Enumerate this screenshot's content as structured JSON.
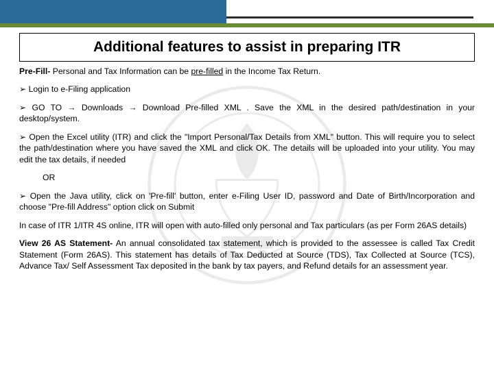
{
  "title": "Additional features to assist in preparing ITR",
  "prefill_label": "Pre-Fill-",
  "prefill_text_before": " Personal and Tax Information can be ",
  "prefill_underlined": "pre-filled",
  "prefill_text_after": " in the Income Tax Return.",
  "bullet1": "Login to e-Filing application",
  "bullet2": "GO TO → Downloads → Download Pre-filled XML . Save the XML in the desired path/destination in your desktop/system.",
  "bullet3": "Open the Excel utility (ITR) and click the \"Import Personal/Tax Details from XML\" button. This will require you to select the path/destination where you have saved the XML and click OK. The details will be uploaded into your utility. You may edit the tax details, if needed",
  "or_text": "OR",
  "bullet4": "Open the Java utility, click on 'Pre-fill' button, enter e-Filing User ID, password and Date of Birth/Incorporation and choose \"Pre-fill Address\" option click on Submit",
  "online_note": "In case of ITR 1/ITR 4S online, ITR will open with auto-filled only personal and Tax particulars (as per Form 26AS details)",
  "view26as_label": "View 26 AS Statement-",
  "view26as_text": " An annual consolidated tax statement, which is provided to the assessee is called Tax Credit Statement (Form 26AS). This statement has details of Tax Deducted at Source (TDS), Tax Collected at Source (TCS), Advance Tax/ Self Assessment Tax deposited in the bank by tax payers, and Refund details for an assessment year."
}
